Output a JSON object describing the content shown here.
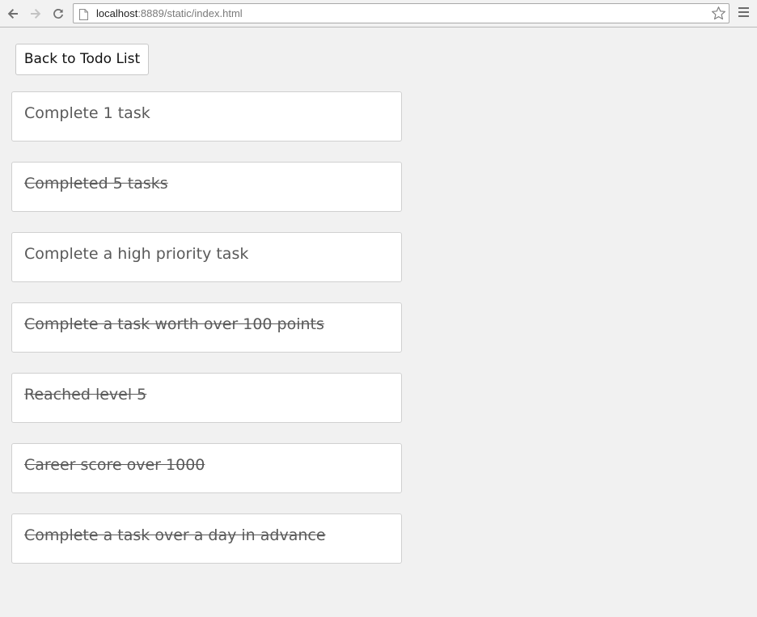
{
  "browser": {
    "url_host": "localhost",
    "url_path": ":8889/static/index.html"
  },
  "page": {
    "back_button_label": "Back to Todo List",
    "achievements": [
      {
        "label": "Complete 1 task",
        "completed": false
      },
      {
        "label": "Completed 5 tasks",
        "completed": true
      },
      {
        "label": "Complete a high priority task",
        "completed": false
      },
      {
        "label": "Complete a task worth over 100 points",
        "completed": true
      },
      {
        "label": "Reached level 5",
        "completed": true
      },
      {
        "label": "Career score over 1000",
        "completed": true
      },
      {
        "label": "Complete a task over a day in advance",
        "completed": true
      }
    ]
  }
}
